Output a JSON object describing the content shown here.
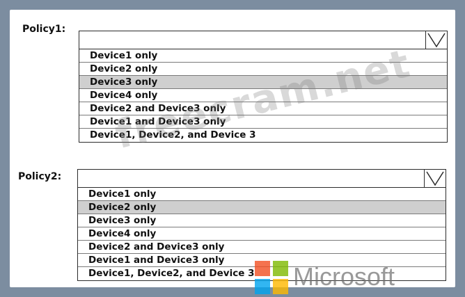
{
  "policy1": {
    "label": "Policy1:",
    "options": [
      "Device1 only",
      "Device2 only",
      "Device3 only",
      "Device4 only",
      "Device2 and Device3 only",
      "Device1 and Device3 only",
      "Device1, Device2, and Device 3"
    ],
    "selected_index": 2
  },
  "policy2": {
    "label": "Policy2:",
    "options": [
      "Device1 only",
      "Device2 only",
      "Device3 only",
      "Device4 only",
      "Device2 and Device3 only",
      "Device1 and Device3 only",
      "Device1, Device2, and Device 3"
    ],
    "selected_index": 1
  },
  "watermark": "freecram.net",
  "brand": {
    "text": "Microsoft",
    "colors": [
      "#f25022",
      "#7fba00",
      "#00a4ef",
      "#ffb900"
    ]
  },
  "colors": {
    "background": "#7c8da0",
    "selected_row": "#cfcfcf"
  }
}
